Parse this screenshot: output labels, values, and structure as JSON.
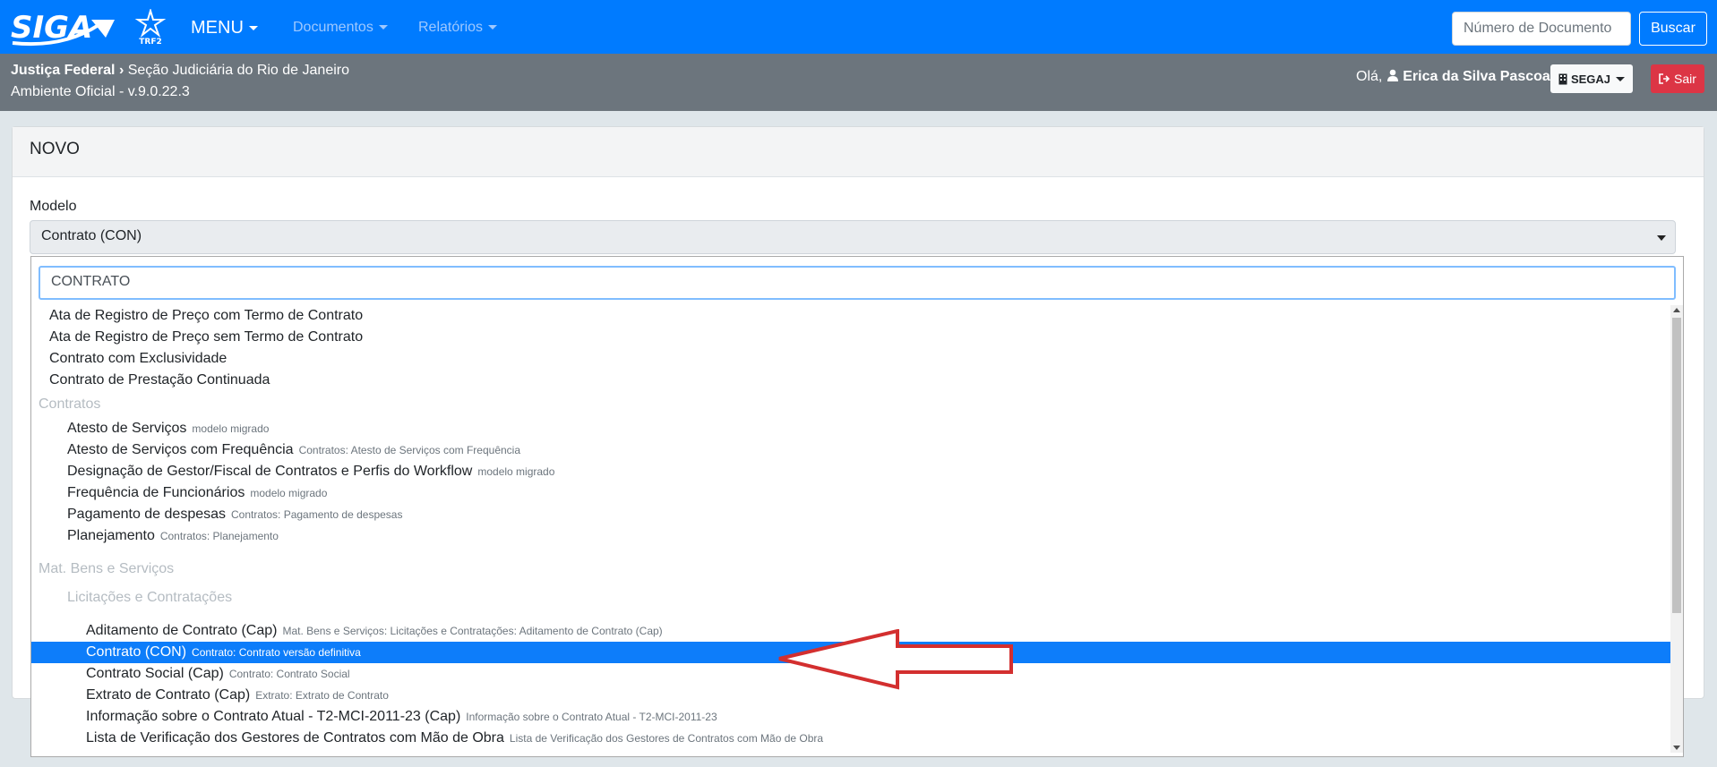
{
  "navbar": {
    "logo_text": "SIGA",
    "org_logo_text": "TRF2",
    "menu_label": "MENU",
    "documentos_label": "Documentos",
    "relatorios_label": "Relatórios",
    "doc_number_placeholder": "Número de Documento",
    "search_button": "Buscar"
  },
  "subheader": {
    "crumb_root": "Justiça Federal",
    "crumb_current": "Seção Judiciária do Rio de Janeiro",
    "environment": "Ambiente Oficial - v.9.0.22.3",
    "greeting": "Olá,",
    "user_name": "Erica da Silva Pascoal",
    "lotacao": "SEGAJ",
    "logout": "Sair"
  },
  "card": {
    "title": "NOVO",
    "modelo_label": "Modelo",
    "modelo_value": "Contrato (CON)"
  },
  "dropdown": {
    "search_value": "CONTRATO",
    "items": [
      {
        "label": "Ata de Registro de Preço com Termo de Contrato",
        "sub": "",
        "level": 0,
        "group": false
      },
      {
        "label": "Ata de Registro de Preço sem Termo de Contrato",
        "sub": "",
        "level": 0,
        "group": false
      },
      {
        "label": "Contrato com Exclusividade",
        "sub": "",
        "level": 0,
        "group": false
      },
      {
        "label": "Contrato de Prestação Continuada",
        "sub": "",
        "level": 0,
        "group": false
      },
      {
        "label": "Contratos",
        "sub": "",
        "level": -1,
        "group": true
      },
      {
        "label": "Atesto de Serviços",
        "sub": "modelo migrado",
        "level": 1,
        "group": false
      },
      {
        "label": "Atesto de Serviços com Frequência",
        "sub": "Contratos: Atesto de Serviços com Frequência",
        "level": 1,
        "group": false
      },
      {
        "label": "Designação de Gestor/Fiscal de Contratos e Perfis do Workflow",
        "sub": "modelo migrado",
        "level": 1,
        "group": false
      },
      {
        "label": "Frequência de Funcionários",
        "sub": "modelo migrado",
        "level": 1,
        "group": false
      },
      {
        "label": "Pagamento de despesas",
        "sub": "Contratos: Pagamento de despesas",
        "level": 1,
        "group": false
      },
      {
        "label": "Planejamento",
        "sub": "Contratos: Planejamento",
        "level": 1,
        "group": false
      },
      {
        "label": "Mat. Bens e Serviços",
        "sub": "",
        "level": -1,
        "group": true
      },
      {
        "label": "Licitações e Contratações",
        "sub": "",
        "level": 1,
        "group": true
      },
      {
        "label": "Aditamento de Contrato (Cap)",
        "sub": "Mat. Bens e Serviços: Licitações e Contratações: Aditamento de Contrato (Cap)",
        "level": 2,
        "group": false
      },
      {
        "label": "Contrato (CON)",
        "sub": "Contrato: Contrato versão definitiva",
        "level": 2,
        "group": false,
        "selected": true
      },
      {
        "label": "Contrato Social (Cap)",
        "sub": "Contrato: Contrato Social",
        "level": 2,
        "group": false
      },
      {
        "label": "Extrato de Contrato (Cap)",
        "sub": "Extrato: Extrato de Contrato",
        "level": 2,
        "group": false
      },
      {
        "label": "Informação sobre o Contrato Atual - T2-MCI-2011-23 (Cap)",
        "sub": "Informação sobre o Contrato Atual - T2-MCI-2011-23",
        "level": 2,
        "group": false
      },
      {
        "label": "Lista de Verificação dos Gestores de Contratos com Mão de Obra",
        "sub": "Lista de Verificação dos Gestores de Contratos com Mão de Obra",
        "level": 2,
        "group": false
      }
    ]
  },
  "colors": {
    "primary": "#007bff",
    "selected": "#0d7dfa",
    "danger": "#dc3545",
    "annotation_arrow": "#d32f2f"
  }
}
